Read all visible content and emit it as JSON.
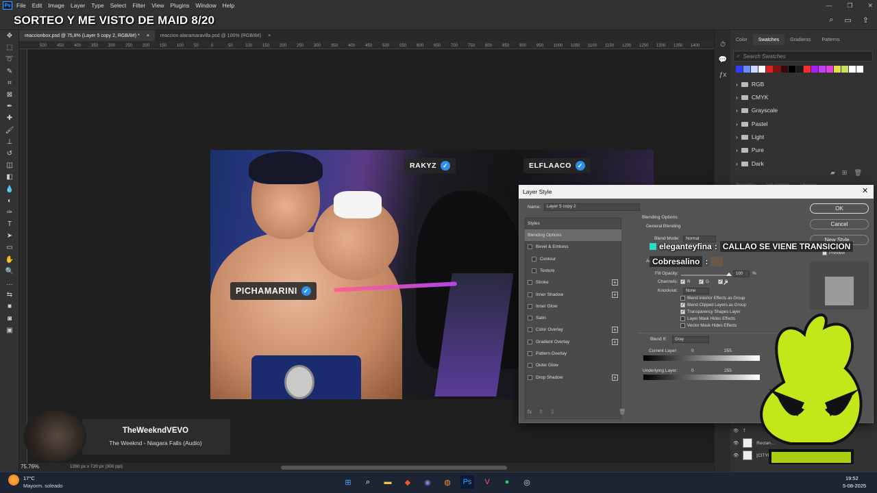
{
  "menu": [
    "File",
    "Edit",
    "Image",
    "Layer",
    "Type",
    "Select",
    "Filter",
    "View",
    "Plugins",
    "Window",
    "Help"
  ],
  "stream_title": "SORTEO Y ME VISTO DE MAID 8/20",
  "tabs": [
    {
      "label": "reaccionbox.psd @ 75,8% (Layer 5 copy 2, RGB/8#) *",
      "close": "×"
    },
    {
      "label": "reaccion alanamaravilla.psd @ 100% (RGB/8#)",
      "close": "×"
    }
  ],
  "ruler_ticks": [
    "500",
    "450",
    "400",
    "350",
    "300",
    "250",
    "200",
    "150",
    "100",
    "50",
    "0",
    "50",
    "100",
    "150",
    "200",
    "250",
    "300",
    "350",
    "400",
    "450",
    "500",
    "550",
    "600",
    "650",
    "700",
    "750",
    "800",
    "850",
    "900",
    "950",
    "1000",
    "1050",
    "1100",
    "1150",
    "1200",
    "1250",
    "1300",
    "1350",
    "1400"
  ],
  "canvas_tags": {
    "rakyz": "RAKYZ",
    "elflaaco": "ELFLAACO",
    "pichamarini": "PICHAMARINI"
  },
  "status": {
    "zoom": "75.76%",
    "doc": "1280 px x 720 px (300 ppi)"
  },
  "panel_tabs": [
    "Color",
    "Swatches",
    "Gradients",
    "Patterns"
  ],
  "swatch_search_placeholder": "Search Swatches",
  "swatch_colors": [
    "#2f3cff",
    "#6b8cff",
    "#cfd8ff",
    "#ffffff",
    "#e02020",
    "#8a1010",
    "#3a0a0a",
    "#000000",
    "#1a1a1a",
    "#ff2a2a",
    "#a020f0",
    "#c040ff",
    "#e040e0",
    "#e0e040",
    "#c8e060",
    "#ffffff",
    "#ffffff"
  ],
  "swatch_groups": [
    "RGB",
    "CMYK",
    "Grayscale",
    "Pastel",
    "Light",
    "Pure",
    "Dark"
  ],
  "props_tabs": [
    "Properties",
    "Adjustments",
    "Libraries"
  ],
  "layers": [
    {
      "label": "T"
    },
    {
      "label": "Rectan..."
    },
    {
      "label": "[CITYPNG.COM]... 2000x4000 copy 2"
    }
  ],
  "dialog": {
    "title": "Layer Style",
    "name_label": "Name:",
    "name_value": "Layer 5 copy 2",
    "styles_header": "Styles",
    "styles": [
      {
        "label": "Blending Options",
        "active": true
      },
      {
        "label": "Bevel & Emboss",
        "cb": true
      },
      {
        "label": "Contour",
        "cb": true,
        "indent": true
      },
      {
        "label": "Texture",
        "cb": true,
        "indent": true
      },
      {
        "label": "Stroke",
        "cb": true,
        "plus": true
      },
      {
        "label": "Inner Shadow",
        "cb": true,
        "plus": true
      },
      {
        "label": "Inner Glow",
        "cb": true
      },
      {
        "label": "Satin",
        "cb": true
      },
      {
        "label": "Color Overlay",
        "cb": true,
        "plus": true
      },
      {
        "label": "Gradient Overlay",
        "cb": true,
        "plus": true
      },
      {
        "label": "Pattern Overlay",
        "cb": true
      },
      {
        "label": "Outer Glow",
        "cb": true
      },
      {
        "label": "Drop Shadow",
        "cb": true,
        "plus": true
      }
    ],
    "fx": "fx",
    "ok": "OK",
    "cancel": "Cancel",
    "new_style": "New Style...",
    "preview": "Preview",
    "blending_options": "Blending Options",
    "general_blending": "General Blending",
    "blend_mode_label": "Blend Mode:",
    "blend_mode_value": "Normal",
    "opacity_label": "Ac",
    "fill_opacity_label": "Fill Opacity:",
    "fill_opacity_value": "100",
    "fill_unit": "%",
    "fill_opacity_fraction": 1.0,
    "channels_label": "Channels:",
    "channels": [
      "R",
      "G",
      "B"
    ],
    "knockout_label": "Knockout:",
    "knockout_value": "None",
    "checks": [
      {
        "label": "Blend Interior Effects as Group",
        "on": false
      },
      {
        "label": "Blend Clipped Layers as Group",
        "on": true
      },
      {
        "label": "Transparency Shapes Layer",
        "on": true
      },
      {
        "label": "Layer Mask Hides Effects",
        "on": false
      },
      {
        "label": "Vector Mask Hides Effects",
        "on": false
      }
    ],
    "blend_if_label": "Blend If:",
    "blend_if_value": "Gray",
    "current_layer": "Current Layer:",
    "underlying_layer": "Underlying Layer:",
    "range_min": "0",
    "range_max": "255"
  },
  "chat": [
    {
      "user": "eleganteyfina",
      "sep": ":",
      "msg": "CALLAO SE VIENE TRANSICION"
    },
    {
      "user": "Cobresalino",
      "sep": ":",
      "msg": ""
    }
  ],
  "music": {
    "artist": "TheWeekndVEVO",
    "song": "The Weeknd - Niagara Falls (Audio)"
  },
  "weather": {
    "temp": "17°C",
    "desc": "Mayorm. soleado"
  },
  "clock": {
    "time": "19:52",
    "date": "5-08-2025"
  }
}
